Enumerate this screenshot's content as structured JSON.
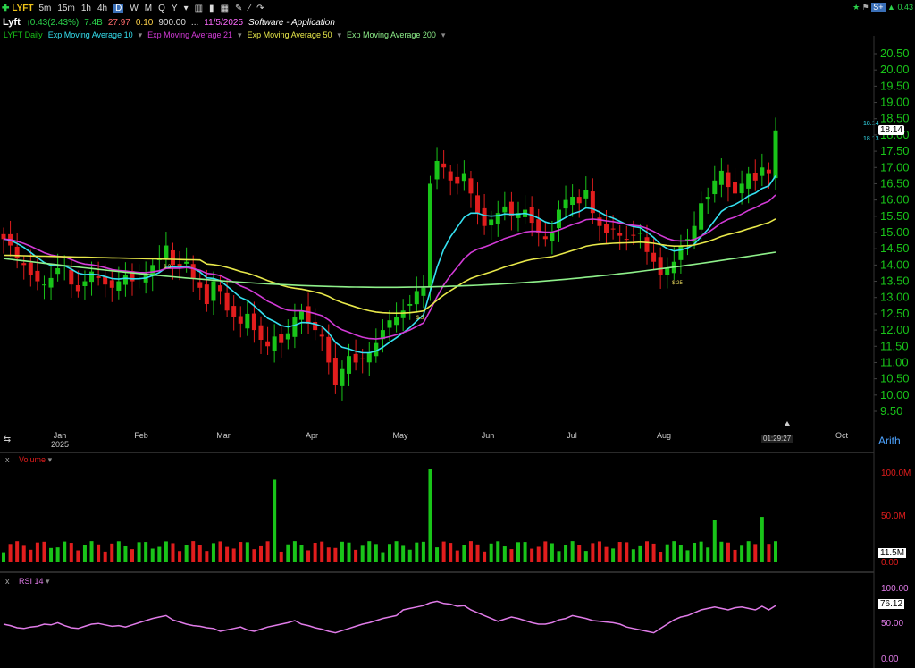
{
  "toolbar": {
    "symbol": "LYFT",
    "timeframes": [
      "5m",
      "15m",
      "1h",
      "4h",
      "D",
      "W",
      "M",
      "Q",
      "Y"
    ],
    "active_timeframe": "D"
  },
  "quote": {
    "name": "Lyft",
    "change": "0.43(2.43%)",
    "volume": "7.4B",
    "pe": "27.97",
    "v1": "0.10",
    "v2": "900.00",
    "date": "11/5/2025",
    "sector": "Software - Application"
  },
  "right_top": {
    "label": "0.43"
  },
  "indicators": {
    "daily": "LYFT Daily",
    "ema10": "Exp Moving Average 10",
    "ema21": "Exp Moving Average 21",
    "ema50": "Exp Moving Average 50",
    "ema200": "Exp Moving Average 200"
  },
  "colors": {
    "up": "#19c419",
    "down": "#e11d1d",
    "ema10": "#35e0f0",
    "ema21": "#d23ad6",
    "ema50": "#e8e84a",
    "ema200": "#8ef08a",
    "rsi": "#e07be8"
  },
  "price_axis": {
    "labels": [
      "20.50",
      "20.00",
      "19.50",
      "19.00",
      "18.50",
      "18.00",
      "17.50",
      "17.00",
      "16.50",
      "16.00",
      "15.50",
      "15.00",
      "14.50",
      "14.00",
      "13.50",
      "13.00",
      "12.50",
      "12.00",
      "11.50",
      "11.00",
      "10.50",
      "10.00",
      "9.50"
    ],
    "last_price": "18.14",
    "hi_label": "18.14",
    "lo_label": "18.13",
    "scale_mode": "Arith",
    "time": "01:29:27"
  },
  "time_axis": {
    "months": [
      "Jan",
      "Feb",
      "Mar",
      "Apr",
      "May",
      "Jun",
      "Jul",
      "Aug",
      "Oct"
    ],
    "year": "2025"
  },
  "volume_pane": {
    "label": "Volume",
    "axis_labels": [
      "100.0M",
      "50.0M",
      "0.00"
    ],
    "last_value": "11.5M"
  },
  "rsi_pane": {
    "label": "RSI 14",
    "axis_labels": [
      "100.00",
      "50.00",
      "0.00"
    ],
    "last_value": "76.12"
  },
  "events": [
    "$.3",
    "$.3",
    "$.25"
  ],
  "chart_data": {
    "type": "line",
    "title": "",
    "xlabel": "",
    "ylabel": "",
    "ylim": [
      9.5,
      20.5
    ],
    "close_series": [
      14.8,
      14.6,
      14.2,
      14.0,
      13.7,
      13.5,
      13.4,
      13.6,
      13.9,
      14.0,
      13.4,
      13.2,
      13.5,
      13.8,
      13.6,
      13.4,
      13.3,
      13.5,
      13.7,
      13.5,
      13.6,
      13.7,
      14.0,
      14.2,
      14.6,
      14.0,
      13.9,
      14.1,
      13.6,
      13.3,
      12.8,
      13.5,
      13.2,
      12.6,
      12.4,
      12.2,
      12.5,
      12.0,
      11.7,
      11.5,
      11.8,
      11.6,
      11.9,
      12.4,
      12.6,
      12.2,
      12.0,
      11.8,
      11.0,
      10.3,
      10.8,
      11.2,
      11.0,
      11.1,
      11.3,
      11.6,
      12.0,
      12.3,
      12.4,
      12.6,
      12.8,
      13.2,
      13.3,
      16.5,
      17.2,
      17.0,
      16.6,
      16.5,
      16.8,
      16.2,
      15.6,
      15.2,
      15.4,
      15.6,
      15.8,
      15.5,
      15.6,
      15.7,
      15.3,
      15.0,
      14.8,
      15.0,
      15.7,
      16.0,
      16.1,
      15.9,
      16.3,
      15.6,
      15.2,
      15.0,
      15.1,
      14.9,
      14.8,
      14.9,
      15.0,
      14.4,
      14.1,
      13.7,
      13.9,
      14.1,
      14.6,
      14.8,
      15.2,
      15.9,
      16.1,
      16.6,
      16.9,
      16.4,
      16.2,
      16.5,
      16.8,
      16.6,
      17.0,
      16.8,
      18.14
    ],
    "rsi_series": [
      50,
      48,
      45,
      44,
      46,
      47,
      50,
      49,
      52,
      48,
      45,
      44,
      47,
      50,
      51,
      49,
      47,
      48,
      46,
      49,
      52,
      55,
      58,
      60,
      62,
      56,
      53,
      50,
      48,
      47,
      45,
      44,
      40,
      42,
      44,
      46,
      42,
      40,
      43,
      46,
      48,
      50,
      52,
      55,
      50,
      48,
      45,
      43,
      40,
      38,
      41,
      44,
      47,
      50,
      52,
      55,
      58,
      60,
      62,
      70,
      72,
      74,
      76,
      80,
      82,
      79,
      78,
      75,
      76,
      70,
      66,
      62,
      58,
      54,
      57,
      60,
      58,
      55,
      52,
      50,
      50,
      52,
      56,
      58,
      62,
      60,
      58,
      55,
      54,
      53,
      52,
      50,
      46,
      44,
      42,
      40,
      38,
      44,
      50,
      56,
      60,
      62,
      66,
      70,
      72,
      74,
      72,
      70,
      73,
      74,
      72,
      70,
      75,
      70,
      76
    ]
  }
}
